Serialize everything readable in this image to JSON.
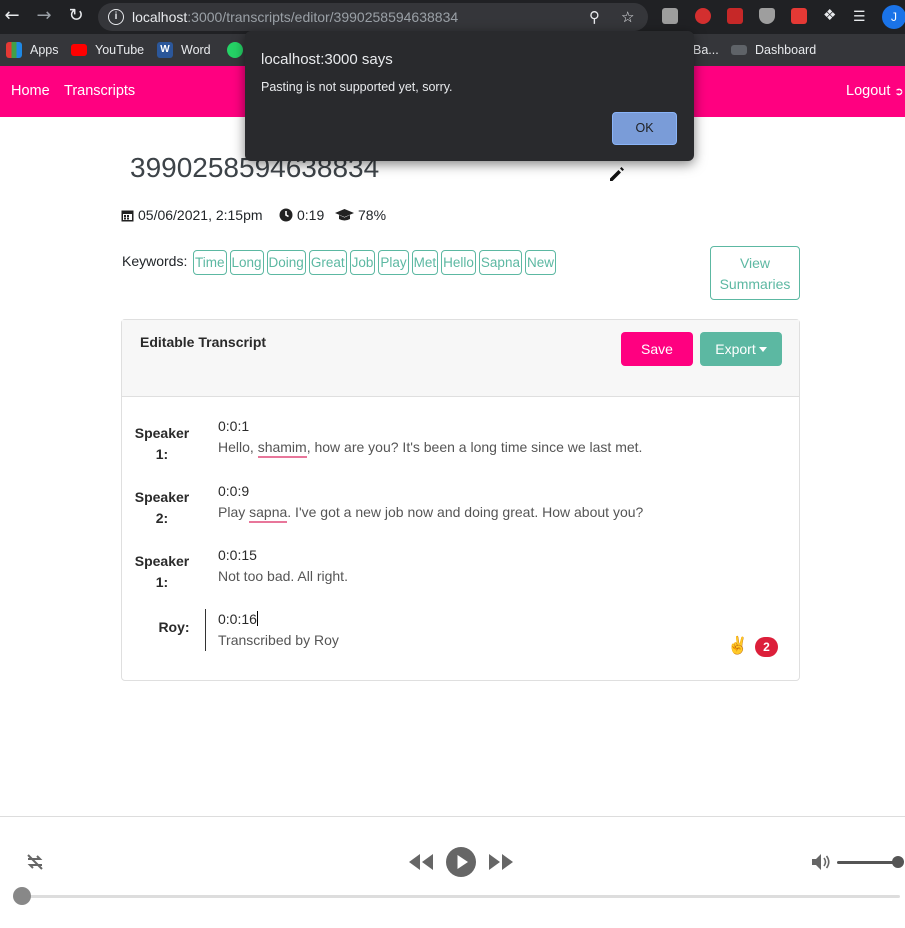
{
  "browser": {
    "url_host": "localhost",
    "url_rest": ":3000/transcripts/editor/3990258594638834",
    "bookmarks": [
      "Apps",
      "YouTube",
      "Word",
      "Ba...",
      "Dashboard"
    ],
    "profile_initial": "J"
  },
  "alert": {
    "title": "localhost:3000 says",
    "message": "Pasting is not supported yet, sorry.",
    "ok_label": "OK"
  },
  "navbar": {
    "home": "Home",
    "transcripts": "Transcripts",
    "logout": "Logout"
  },
  "transcript": {
    "title": "3990258594638834",
    "date": "05/06/2021, 2:15pm",
    "duration": "0:19",
    "accuracy": "78%",
    "keywords_label": "Keywords:",
    "keywords": [
      "Time",
      "Long",
      "Doing",
      "Great",
      "Job",
      "Play",
      "Met",
      "Hello",
      "Sapna",
      "New"
    ],
    "view_summaries": "View Summaries"
  },
  "editor": {
    "title": "Editable Transcript",
    "save_label": "Save",
    "export_label": "Export",
    "segments": [
      {
        "speaker": "Speaker 1:",
        "time": "0:0:1",
        "text_pre": "Hello, ",
        "text_flag": "shamim",
        "text_post": ", how are you? It's been a long time since we last met."
      },
      {
        "speaker": "Speaker 2:",
        "time": "0:0:9",
        "text_pre": "Play ",
        "text_flag": "sapna",
        "text_post": ". I've got a new job now and doing great. How about you?"
      },
      {
        "speaker": "Speaker 1:",
        "time": "0:0:15",
        "text_pre": "Not too bad. All right.",
        "text_flag": "",
        "text_post": ""
      },
      {
        "speaker": "Roy:",
        "time": "0:0:16",
        "text_pre": "Transcribed by Roy",
        "text_flag": "",
        "text_post": ""
      }
    ],
    "grammar_badge": "2",
    "grammar_emoji": "✌️"
  },
  "player": {
    "progress": 0,
    "volume": 1.0
  },
  "colors": {
    "brand": "#ff0080",
    "accent": "#5cb8a2",
    "badge": "#dc1f3a"
  }
}
